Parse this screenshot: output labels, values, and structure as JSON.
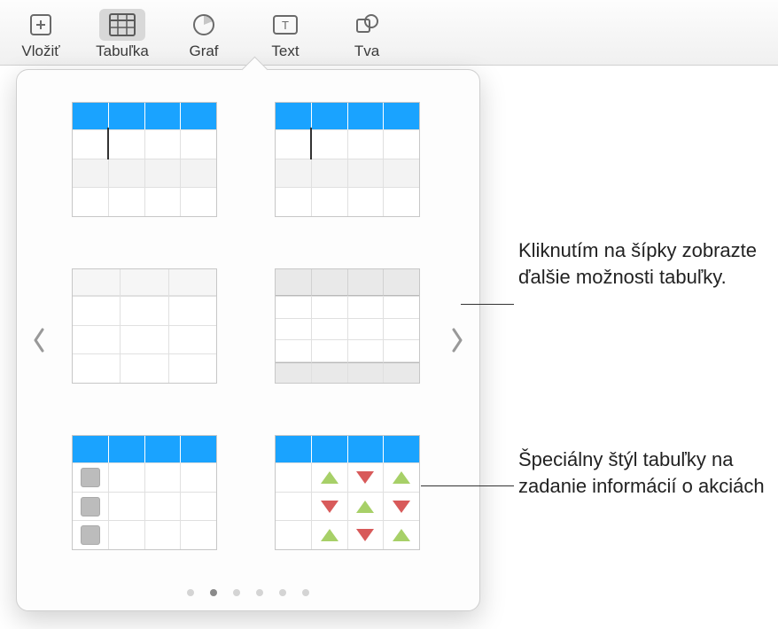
{
  "toolbar": {
    "items": [
      {
        "id": "insert",
        "label": "Vložiť"
      },
      {
        "id": "table",
        "label": "Tabuľka",
        "active": true
      },
      {
        "id": "chart",
        "label": "Graf"
      },
      {
        "id": "text",
        "label": "Text"
      },
      {
        "id": "shape",
        "label": "Tva"
      }
    ]
  },
  "popover": {
    "nav_prev": "chevron-left",
    "nav_next": "chevron-right",
    "page_count": 6,
    "page_active_index": 1,
    "styles": [
      {
        "id": "style-blue-header-1",
        "header": "blue",
        "rows": 3,
        "cols": 4,
        "features": [
          "cursor"
        ]
      },
      {
        "id": "style-blue-header-2",
        "header": "blue",
        "rows": 3,
        "cols": 4,
        "features": [
          "cursor"
        ]
      },
      {
        "id": "style-plain",
        "header": "plain",
        "rows": 3,
        "cols": 3,
        "features": []
      },
      {
        "id": "style-grey-header-footer",
        "header": "plain",
        "rows": 4,
        "cols": 4,
        "features": [
          "footer"
        ]
      },
      {
        "id": "style-checkboxes",
        "header": "blue",
        "rows": 3,
        "cols": 4,
        "features": [
          "checkbox-first-col"
        ]
      },
      {
        "id": "style-stock-arrows",
        "header": "blue",
        "rows": 3,
        "cols": 4,
        "features": [
          "stock-arrows"
        ]
      }
    ]
  },
  "callouts": {
    "arrows": "Kliknutím na šípky zobrazte ďalšie možnosti tabuľky.",
    "stock": "Špeciálny štýl tabuľky na zadanie informácií o akciách"
  }
}
